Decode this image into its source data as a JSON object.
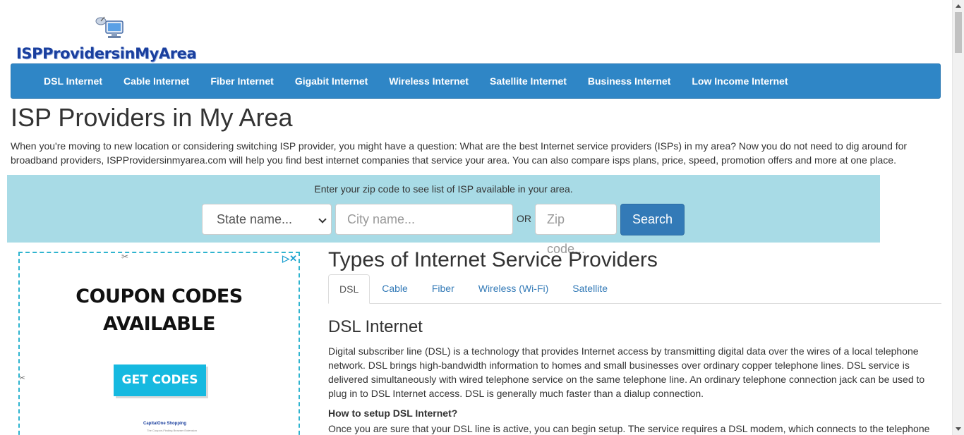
{
  "logo": {
    "text": "ISPProvidersinMyArea",
    "icon": "computer-satellite-icon"
  },
  "nav": {
    "items": [
      {
        "label": "DSL Internet"
      },
      {
        "label": "Cable Internet"
      },
      {
        "label": "Fiber Internet"
      },
      {
        "label": "Gigabit Internet"
      },
      {
        "label": "Wireless Internet"
      },
      {
        "label": "Satellite Internet"
      },
      {
        "label": "Business Internet"
      },
      {
        "label": "Low Income Internet"
      }
    ]
  },
  "page": {
    "title": "ISP Providers in My Area",
    "intro": "When you're moving to new location or considering switching ISP provider, you might have a question: What are the best Internet service providers (ISPs) in my area? Now you do not need to dig around for broadband providers, ISPProvidersinmyarea.com will help you find best internet companies that service your area. You can also compare isps plans, price, speed, promotion offers and more at one place."
  },
  "search": {
    "prompt": "Enter your zip code to see list of ISP available in your area.",
    "state_value": "State name...",
    "city_placeholder": "City name...",
    "or_label": "OR",
    "zip_placeholder": "Zip code...",
    "button_label": "Search"
  },
  "ad": {
    "choices_icon": "ad-choices-icon",
    "title_line1": "COUPON CODES",
    "title_line2": "AVAILABLE",
    "button_label": "GET CODES",
    "brand": "CapitalOne Shopping",
    "brand_sub": "The Coupon-Finding Browser Extension"
  },
  "content": {
    "types_title": "Types of Internet Service Providers",
    "tabs": [
      {
        "label": "DSL",
        "active": true
      },
      {
        "label": "Cable"
      },
      {
        "label": "Fiber"
      },
      {
        "label": "Wireless (Wi-Fi)"
      },
      {
        "label": "Satellite"
      }
    ],
    "section_title": "DSL Internet",
    "section_body": "Digital subscriber line (DSL) is a technology that provides Internet access by transmitting digital data over the wires of a local telephone network. DSL brings high-bandwidth information to homes and small businesses over ordinary copper telephone lines. DSL service is delivered simultaneously with wired telephone service on the same telephone line. An ordinary telephone connection jack can be used to plug in to DSL Internet access. DSL is generally much faster than a dialup connection.",
    "setup_title": "How to setup DSL Internet?",
    "setup_body": "Once you are sure that your DSL line is active, you can begin setup. The service requires a DSL modem, which connects to the telephone"
  },
  "colors": {
    "nav_bg": "#2f86c6",
    "search_band_bg": "#a8dbe6",
    "button_primary": "#337ab7",
    "ad_accent": "#16b9e0"
  }
}
